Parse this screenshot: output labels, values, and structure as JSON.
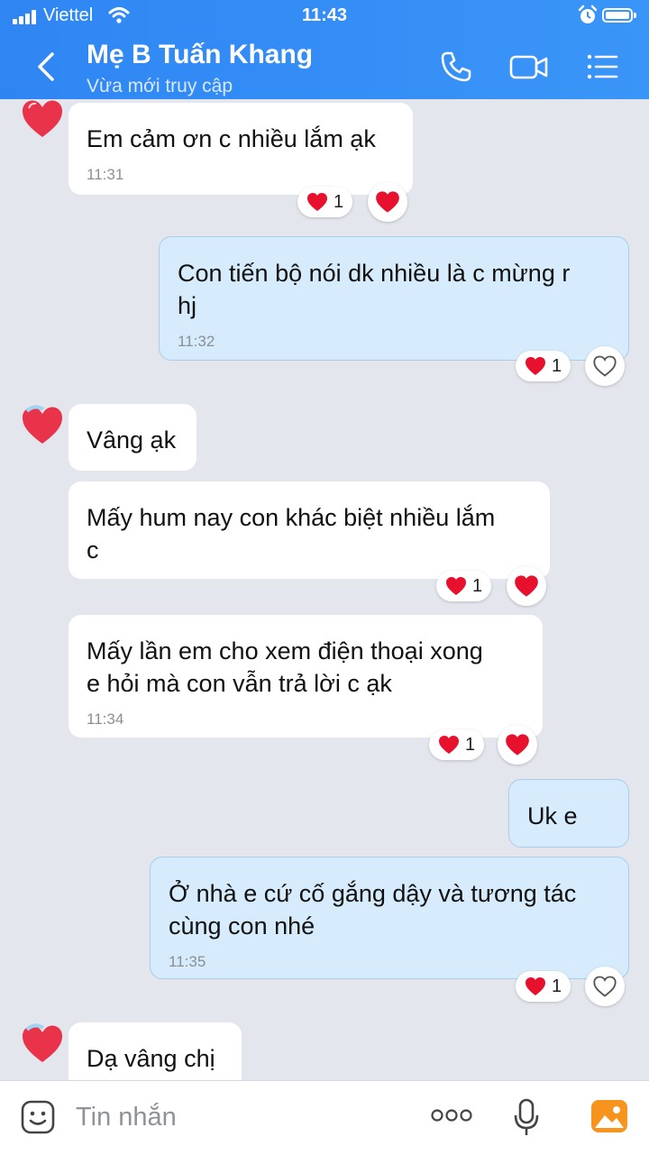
{
  "status_bar": {
    "carrier": "Viettel",
    "time": "11:43"
  },
  "header": {
    "title": "Mẹ B Tuấn Khang",
    "subtitle": "Vừa mới truy cập",
    "icons": [
      "back-icon",
      "phone-icon",
      "video-call-icon",
      "menu-list-icon"
    ]
  },
  "messages": [
    {
      "from": "contact",
      "lines": [
        "Em cảm ơn c nhiều lắm ạk"
      ],
      "time": "11:31",
      "reaction_count": "1"
    },
    {
      "from": "me",
      "lines": [
        "Con tiến bộ nói dk nhiều là c mừng r",
        "hj"
      ],
      "time": "11:32",
      "reaction_count": "1"
    },
    {
      "from": "contact",
      "lines": [
        "Vâng ạk"
      ]
    },
    {
      "from": "contact",
      "lines": [
        "Mấy hum nay con khác biệt nhiều lắm",
        "c"
      ],
      "reaction_count": "1"
    },
    {
      "from": "contact",
      "lines": [
        "Mấy lần em cho xem điện thoại xong",
        "e hỏi mà con vẫn trả lời c ạk"
      ],
      "time": "11:34",
      "reaction_count": "1"
    },
    {
      "from": "me",
      "lines": [
        "Uk e"
      ]
    },
    {
      "from": "me",
      "lines": [
        "Ở nhà e cứ cố gắng dậy và tương tác",
        "cùng con nhé"
      ],
      "time": "11:35",
      "reaction_count": "1"
    },
    {
      "from": "contact",
      "lines": [
        "Dạ vâng chị"
      ]
    }
  ],
  "input": {
    "placeholder": "Tin nhắn"
  },
  "colors": {
    "header": "#3a95f8",
    "heart": "#e8112d",
    "outgoing_bubble": "#d6ebfb",
    "background": "#e3e6ec"
  }
}
